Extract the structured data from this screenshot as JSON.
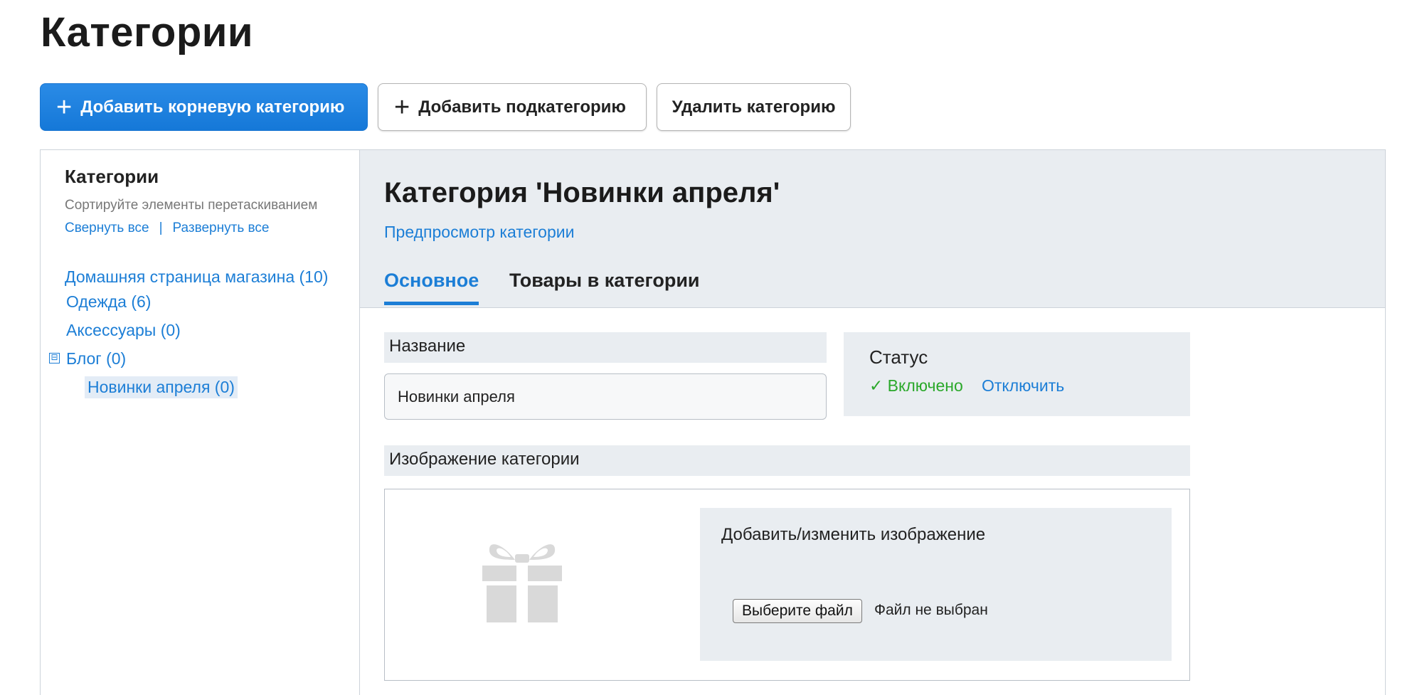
{
  "page": {
    "title": "Категории"
  },
  "toolbar": {
    "add_root_label": "Добавить корневую категорию",
    "add_sub_label": "Добавить подкатегорию",
    "delete_label": "Удалить категорию"
  },
  "sidebar": {
    "title": "Категории",
    "hint": "Сортируйте элементы перетаскиванием",
    "collapse_all": "Свернуть все",
    "separator": "|",
    "expand_all": "Развернуть все",
    "tree": [
      {
        "label": "Домашняя страница магазина (10)"
      },
      {
        "label": "Одежда (6)"
      },
      {
        "label": "Аксессуары (0)"
      },
      {
        "label": "Блог (0)",
        "toggle": "⊟"
      },
      {
        "label": "Новинки апреля (0)",
        "selected": true
      }
    ]
  },
  "main": {
    "heading": "Категория 'Новинки апреля'",
    "preview_link": "Предпросмотр категории",
    "tabs": [
      {
        "label": "Основное",
        "active": true
      },
      {
        "label": "Товары в категории"
      }
    ],
    "name": {
      "label": "Название",
      "value": "Новинки апреля"
    },
    "status": {
      "title": "Статус",
      "enabled": "✓ Включено",
      "disable": "Отключить"
    },
    "image": {
      "label": "Изображение категории",
      "upload_title": "Добавить/изменить изображение",
      "choose_file": "Выберите файл",
      "no_file": "Файл не выбран"
    }
  },
  "colors": {
    "accent": "#1c7ed6",
    "success": "#2aa82a",
    "header_bg": "#e9edf1"
  },
  "icons": {
    "add": "plus-icon",
    "toggle": "minus-square-icon",
    "status": "checkmark-icon",
    "placeholder": "gift-icon"
  }
}
